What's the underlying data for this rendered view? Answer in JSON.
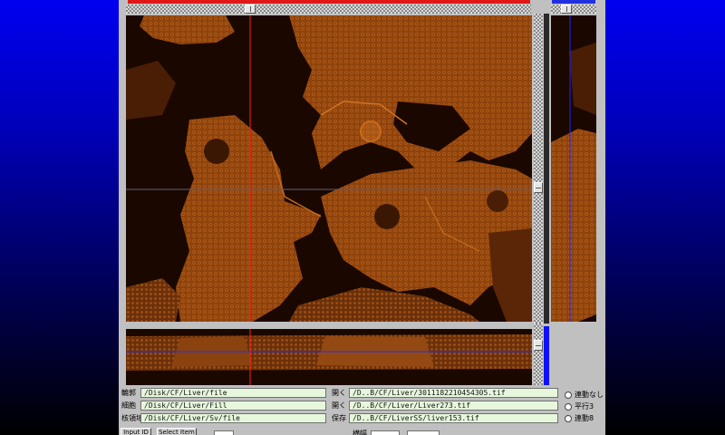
{
  "form": {
    "label_a": "輪郭",
    "label_b": "細胞",
    "label_c": "核領域",
    "path_a": "/Disk/CF/Liver/file",
    "path_b": "/Disk/CF/Liver/Fill",
    "path_c": "/Disk/CF/Liver/Sv/file",
    "right_label_a": "開く",
    "right_label_b": "開く",
    "right_label_c": "保存",
    "right_path_a": "/D..B/CF/Liver/3011182210454305.tif",
    "right_path_b": "/D..B/CF/Liver/Liver273.tif",
    "right_path_c": "/D..B/CF/LiverSS/liver153.tif"
  },
  "options": {
    "radio_1": "連動なし",
    "radio_2": "平行3",
    "radio_3": "連動8"
  },
  "bottom": {
    "button_1": "Input ID",
    "button_2": "Select Item",
    "label": "横幅"
  },
  "colors": {
    "accent_red": "#ff1010",
    "crosshair_blue": "#1010ff",
    "tissue": "#b45a14"
  }
}
